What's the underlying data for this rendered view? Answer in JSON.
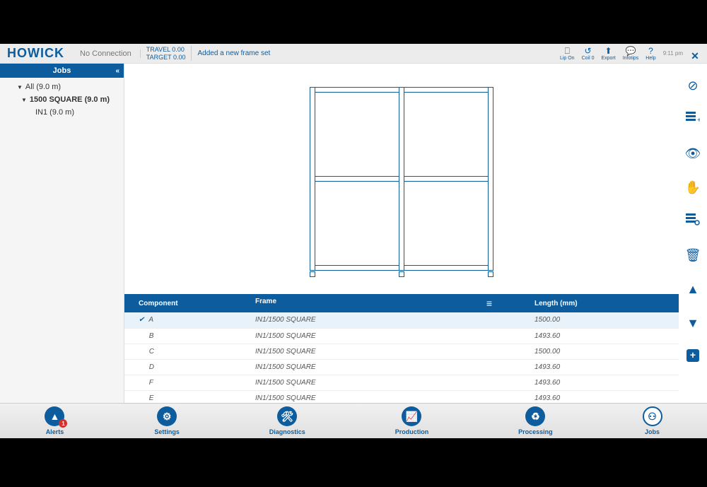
{
  "header": {
    "logo": "HOWICK",
    "connection": "No Connection",
    "travel": "TRAVEL 0.00",
    "target": "TARGET 0.00",
    "status_message": "Added a new frame set",
    "buttons": {
      "lipon": "Lip On",
      "coil": "Coil 0",
      "export": "Export",
      "infotips": "Infotips",
      "help": "Help"
    },
    "time": "9:11 pm"
  },
  "sidebar": {
    "title": "Jobs",
    "tree": {
      "root": "All (9.0 m)",
      "job": "1500 SQUARE (9.0 m)",
      "item": "IN1 (9.0 m)"
    }
  },
  "table": {
    "columns": {
      "component": "Component",
      "frame": "Frame",
      "length": "Length (mm)"
    },
    "rows": [
      {
        "component": "A",
        "frame": "IN1/1500 SQUARE",
        "length": "1500.00",
        "selected": true
      },
      {
        "component": "B",
        "frame": "IN1/1500 SQUARE",
        "length": "1493.60",
        "selected": false
      },
      {
        "component": "C",
        "frame": "IN1/1500 SQUARE",
        "length": "1500.00",
        "selected": false
      },
      {
        "component": "D",
        "frame": "IN1/1500 SQUARE",
        "length": "1493.60",
        "selected": false
      },
      {
        "component": "F",
        "frame": "IN1/1500 SQUARE",
        "length": "1493.60",
        "selected": false
      },
      {
        "component": "E",
        "frame": "IN1/1500 SQUARE",
        "length": "1493.60",
        "selected": false
      }
    ]
  },
  "bottom_nav": {
    "alerts": "Alerts",
    "alerts_badge": "1",
    "settings": "Settings",
    "diagnostics": "Diagnostics",
    "production": "Production",
    "processing": "Processing",
    "jobs": "Jobs"
  }
}
